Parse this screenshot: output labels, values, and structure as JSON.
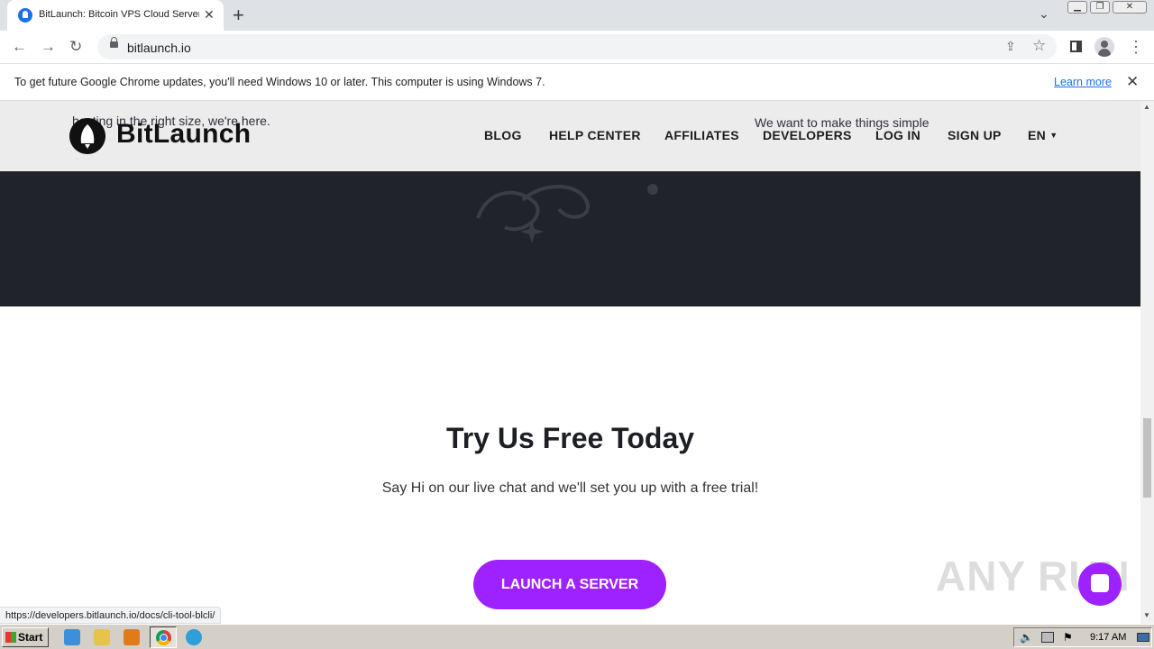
{
  "browser": {
    "tab_title": "BitLaunch: Bitcoin VPS Cloud Servers",
    "new_tab": "+",
    "url": "bitlaunch.io",
    "infobar_message": "To get future Google Chrome updates, you'll need Windows 10 or later. This computer is using Windows 7.",
    "infobar_link": "Learn more",
    "status_url": "https://developers.bitlaunch.io/docs/cli-tool-blcli/"
  },
  "site": {
    "brand": "BitLaunch",
    "nav": [
      "BLOG",
      "HELP CENTER",
      "AFFILIATES",
      "DEVELOPERS",
      "LOG IN",
      "SIGN UP",
      "EN"
    ],
    "ghost_left": "hosting in the right size, we're here.",
    "ghost_right": "We want to make things simple"
  },
  "cta": {
    "title": "Try Us Free Today",
    "subtitle": "Say Hi on our live chat and we'll set you up with a free trial!",
    "button": "LAUNCH A SERVER"
  },
  "watermark": "ANY RUN",
  "taskbar": {
    "start": "Start",
    "clock": "9:17 AM"
  },
  "colors": {
    "accent": "#9e22ff",
    "dark_bg": "#20232a"
  }
}
